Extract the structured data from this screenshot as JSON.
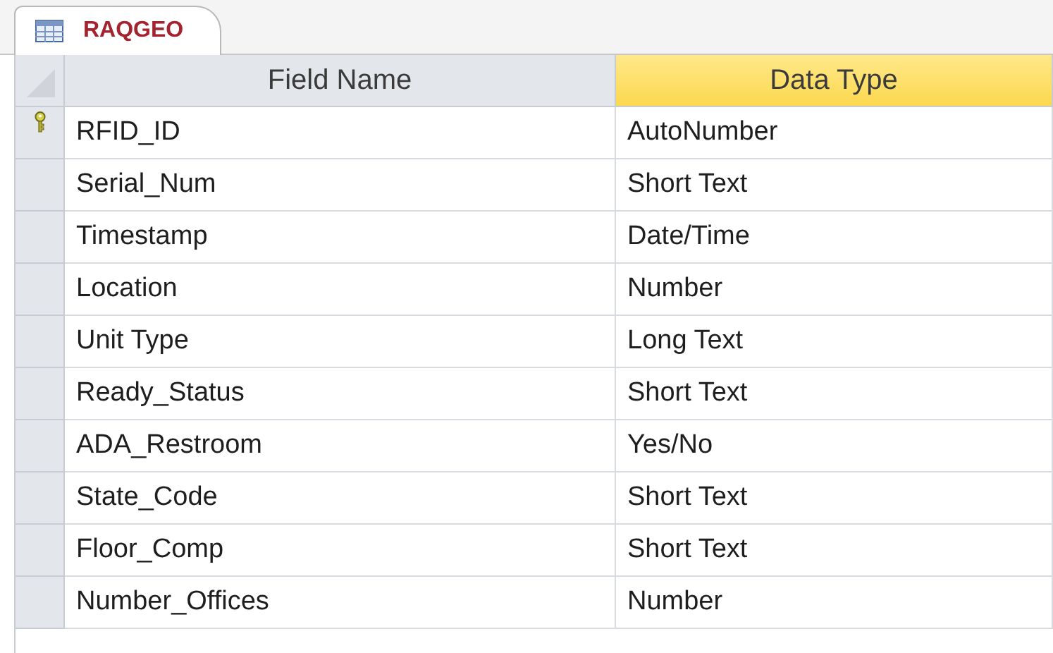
{
  "tab": {
    "title": "RAQGEO",
    "selected": true
  },
  "table": {
    "columns": [
      {
        "label": "Field Name",
        "selected": false
      },
      {
        "label": "Data Type",
        "selected": true
      }
    ],
    "rows": [
      {
        "field_name": "RFID_ID",
        "data_type": "AutoNumber",
        "primary_key": true
      },
      {
        "field_name": "Serial_Num",
        "data_type": "Short Text",
        "primary_key": false
      },
      {
        "field_name": "Timestamp",
        "data_type": "Date/Time",
        "primary_key": false
      },
      {
        "field_name": "Location",
        "data_type": "Number",
        "primary_key": false
      },
      {
        "field_name": "Unit Type",
        "data_type": "Long Text",
        "primary_key": false
      },
      {
        "field_name": "Ready_Status",
        "data_type": "Short Text",
        "primary_key": false
      },
      {
        "field_name": "ADA_Restroom",
        "data_type": "Yes/No",
        "primary_key": false
      },
      {
        "field_name": "State_Code",
        "data_type": "Short Text",
        "primary_key": false
      },
      {
        "field_name": "Floor_Comp",
        "data_type": "Short Text",
        "primary_key": false
      },
      {
        "field_name": "Number_Offices",
        "data_type": "Number",
        "primary_key": false
      }
    ]
  }
}
